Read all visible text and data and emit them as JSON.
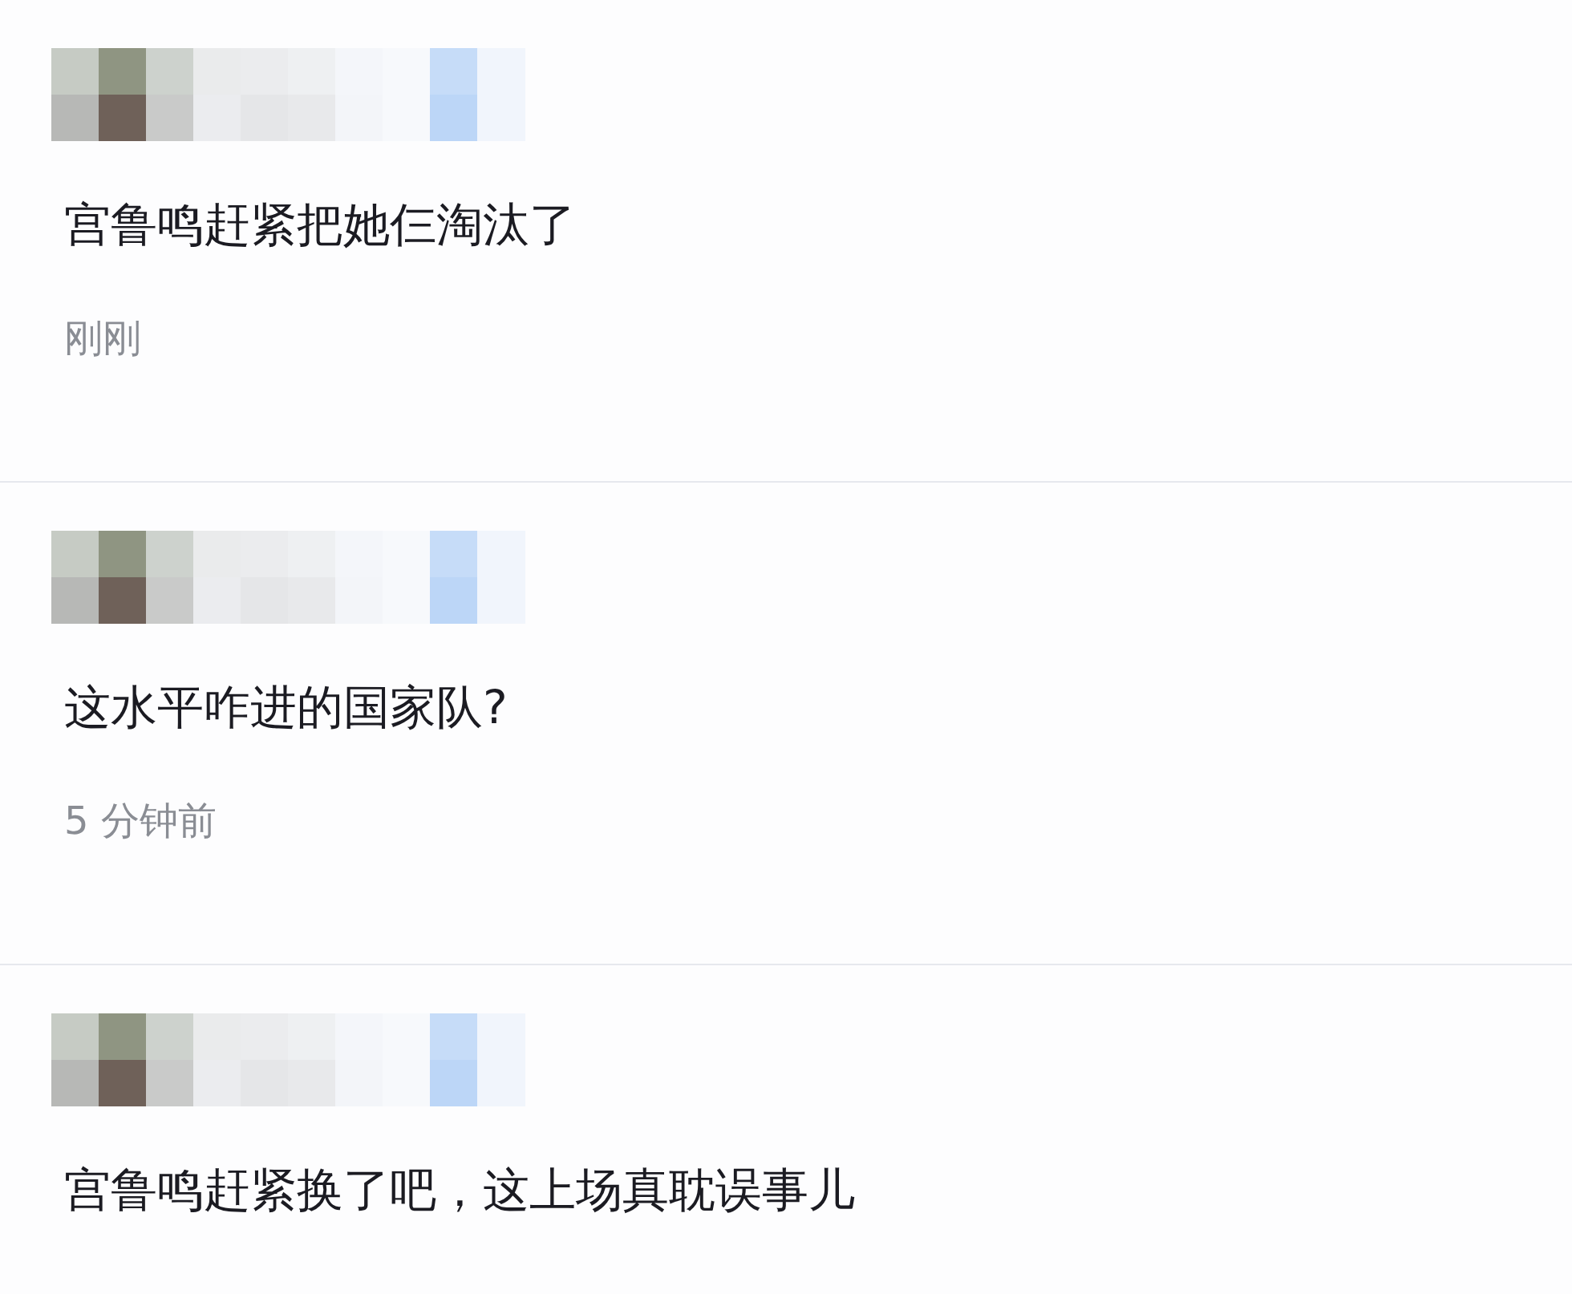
{
  "comments": [
    {
      "text": "宫鲁鸣赶紧把她仨淘汰了",
      "time": "刚刚"
    },
    {
      "text": "这水平咋进的国家队?",
      "time": "5 分钟前"
    },
    {
      "text": "宫鲁鸣赶紧换了吧，这上场真耽误事儿"
    }
  ]
}
